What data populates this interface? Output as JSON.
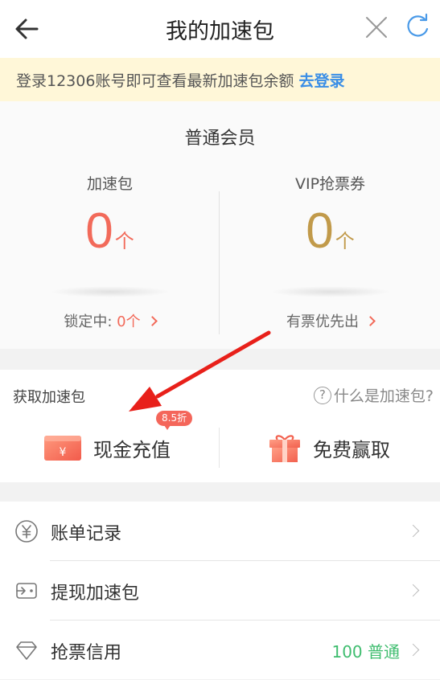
{
  "header": {
    "title": "我的加速包",
    "back_icon": "arrow-left-icon",
    "close_icon": "close-icon",
    "refresh_icon": "refresh-icon"
  },
  "banner": {
    "text": "登录12306账号即可查看最新加速包余额",
    "link": "去登录"
  },
  "member": {
    "title": "普通会员",
    "left": {
      "label": "加速包",
      "value": "0",
      "unit": "个",
      "foot_label": "锁定中: ",
      "foot_value": "0个"
    },
    "right": {
      "label": "VIP抢票券",
      "value": "0",
      "unit": "个",
      "foot_label": "有票优先出"
    }
  },
  "get": {
    "title": "获取加速包",
    "help": "什么是加速包?",
    "cash": {
      "label": "现金充值",
      "badge": "8.5折",
      "icon": "wallet-icon"
    },
    "free": {
      "label": "免费赢取",
      "icon": "gift-icon"
    }
  },
  "list": [
    {
      "label": "账单记录",
      "icon": "yen-circle-icon"
    },
    {
      "label": "提现加速包",
      "icon": "withdraw-icon"
    },
    {
      "label": "抢票信用",
      "value": "100 普通",
      "icon": "diamond-icon"
    }
  ],
  "colors": {
    "accent_red": "#f26a5a",
    "gold": "#c19a4a",
    "link_blue": "#3a8ee6",
    "credit_green": "#3fbd6f",
    "banner_bg": "#fff7d8"
  }
}
